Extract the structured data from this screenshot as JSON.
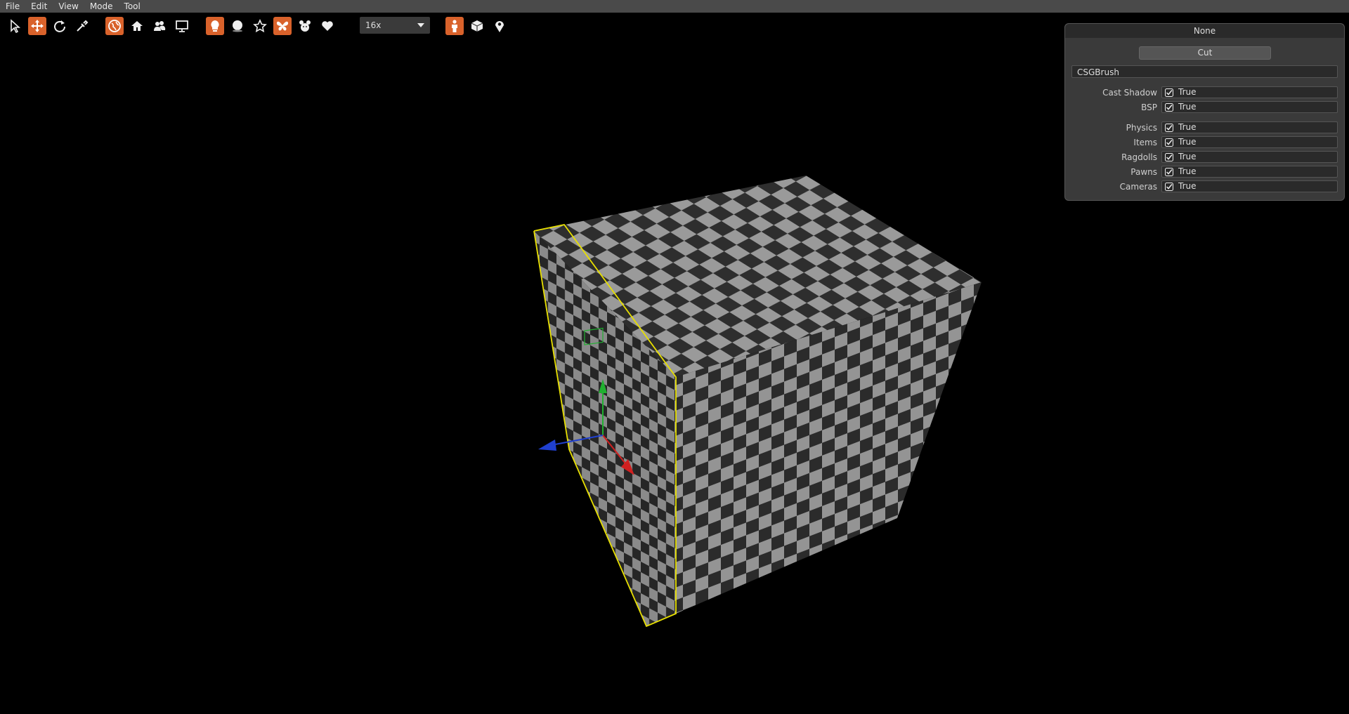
{
  "menubar": {
    "items": [
      "File",
      "Edit",
      "View",
      "Mode",
      "Tool"
    ]
  },
  "toolbar": {
    "tools": [
      {
        "icon": "select-arrow-icon",
        "active": false
      },
      {
        "icon": "move-icon",
        "active": true
      },
      {
        "icon": "rotate-icon",
        "active": false
      },
      {
        "icon": "eyedropper-icon",
        "active": false
      }
    ],
    "modes": [
      {
        "icon": "globe-icon",
        "active": true
      },
      {
        "icon": "house-icon",
        "active": false
      },
      {
        "icon": "people-icon",
        "active": false
      },
      {
        "icon": "monitor-icon",
        "active": false
      }
    ],
    "entities": [
      {
        "icon": "lightbulb-icon",
        "active": true
      },
      {
        "icon": "sphere-icon",
        "active": false
      },
      {
        "icon": "star-icon",
        "active": false
      },
      {
        "icon": "butterfly-icon",
        "active": true
      },
      {
        "icon": "creatures-icon",
        "active": false
      },
      {
        "icon": "heart-icon",
        "active": false
      }
    ],
    "zoom": "16x",
    "view_modes": [
      {
        "icon": "person-icon",
        "active": true
      },
      {
        "icon": "cube-icon",
        "active": false
      },
      {
        "icon": "map-pin-icon",
        "active": false
      }
    ]
  },
  "properties": {
    "title": "None",
    "action_button": "Cut",
    "class_name": "CSGBrush",
    "rows": [
      {
        "label": "Cast Shadow",
        "value": "True"
      },
      {
        "label": "BSP",
        "value": "True"
      },
      {
        "label": "Physics",
        "value": "True"
      },
      {
        "label": "Items",
        "value": "True"
      },
      {
        "label": "Ragdolls",
        "value": "True"
      },
      {
        "label": "Pawns",
        "value": "True"
      },
      {
        "label": "Cameras",
        "value": "True"
      }
    ]
  },
  "colors": {
    "accent": "#d9622b",
    "selection": "#e8e000",
    "axis_x": "#d02020",
    "axis_y": "#20b030",
    "axis_z": "#2040d0",
    "checker_light": "#9a9a9a",
    "checker_dark": "#2e2e2e"
  }
}
